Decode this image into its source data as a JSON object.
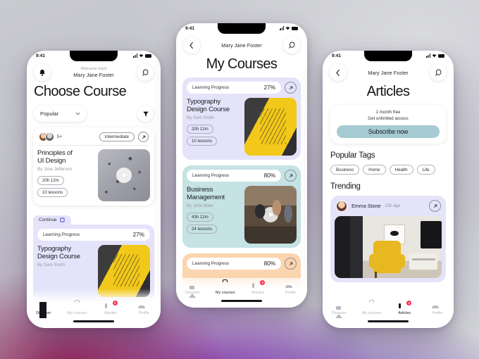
{
  "status_bar": {
    "time": "9:41"
  },
  "phone_left": {
    "header": {
      "welcome_small": "Welcome back",
      "user_name": "Mary Jane Foster",
      "bell_icon": "bell-icon",
      "search_icon": "search-icon"
    },
    "title": "Choose Course",
    "filter": {
      "selected": "Popular",
      "chevron_icon": "chevron-down-icon",
      "funnel_icon": "filter-funnel-icon"
    },
    "course_card": {
      "avatar_count": "5+",
      "level": "Intermediate",
      "arrow_icon": "arrow-up-right-icon",
      "title": "Principles of\nUI Design",
      "title_line1": "Principles of",
      "title_line2": "UI Design",
      "author": "By Jose Jefferson",
      "duration": "20h 12m",
      "lessons": "10 lessons",
      "play_icon": "play-icon"
    },
    "continue": {
      "tab_label": "Continue",
      "tab_icon": "video-icon",
      "progress_label": "Learning Progress",
      "progress_value": "27%",
      "title_line1": "Typography",
      "title_line2": "Design Course",
      "author": "By Sam Smith"
    },
    "nav": [
      {
        "label": "Discover",
        "icon": "home-icon",
        "active": true,
        "badge": ""
      },
      {
        "label": "My courses",
        "icon": "briefcase-icon",
        "active": false,
        "badge": ""
      },
      {
        "label": "Articles",
        "icon": "articles-icon",
        "active": false,
        "badge": "2"
      },
      {
        "label": "Profile",
        "icon": "person-icon",
        "active": false,
        "badge": ""
      }
    ]
  },
  "phone_center": {
    "header": {
      "back_icon": "chevron-left-icon",
      "user_name": "Mary Jane Foster",
      "search_icon": "search-icon"
    },
    "title": "My Courses",
    "cards": [
      {
        "progress_label": "Learning Progress",
        "progress_value": "27%",
        "arrow_icon": "arrow-up-right-icon",
        "title_line1": "Typography",
        "title_line2": "Design Course",
        "author": "By Sam Smith",
        "duration": "20h 12m",
        "lessons": "10 lessons",
        "color": "#e4e3fa",
        "has_play": false
      },
      {
        "progress_label": "Learning Progress",
        "progress_value": "80%",
        "arrow_icon": "arrow-up-right-icon",
        "title_line1": "Business",
        "title_line2": "Management",
        "author": "By John Mate",
        "duration": "43h 12m",
        "lessons": "24 lessons",
        "color": "#c5e2e4",
        "has_play": true
      },
      {
        "progress_label": "Learning Progress",
        "progress_value": "80%",
        "arrow_icon": "arrow-up-right-icon",
        "title_line1": "",
        "title_line2": "",
        "author": "",
        "duration": "",
        "lessons": "",
        "color": "#fbd5ae",
        "has_play": false
      }
    ],
    "nav": [
      {
        "label": "Discover",
        "icon": "home-icon",
        "active": false,
        "badge": ""
      },
      {
        "label": "My courses",
        "icon": "briefcase-icon",
        "active": true,
        "badge": ""
      },
      {
        "label": "Articles",
        "icon": "articles-icon",
        "active": false,
        "badge": "2"
      },
      {
        "label": "Profile",
        "icon": "person-icon",
        "active": false,
        "badge": ""
      }
    ]
  },
  "phone_right": {
    "header": {
      "back_icon": "chevron-left-icon",
      "user_name": "Mary Jane Foster",
      "search_icon": "search-icon"
    },
    "title": "Articles",
    "promo": {
      "line1": "1 month free",
      "line2": "Get unlimited access",
      "button": "Subscribe now",
      "button_color": "#a6cbd2"
    },
    "popular_tags_title": "Popular Tags",
    "tags": [
      "Business",
      "Home",
      "Health",
      "Life"
    ],
    "trending_title": "Trending",
    "trending_card": {
      "author": "Emma Stone",
      "time": "23h ago",
      "arrow_icon": "arrow-up-right-icon",
      "avatar": "avatar"
    },
    "nav": [
      {
        "label": "Discover",
        "icon": "home-icon",
        "active": false,
        "badge": ""
      },
      {
        "label": "My courses",
        "icon": "briefcase-icon",
        "active": false,
        "badge": ""
      },
      {
        "label": "Articles",
        "icon": "articles-icon",
        "active": true,
        "badge": "2"
      },
      {
        "label": "Profile",
        "icon": "person-icon",
        "active": false,
        "badge": ""
      }
    ]
  }
}
